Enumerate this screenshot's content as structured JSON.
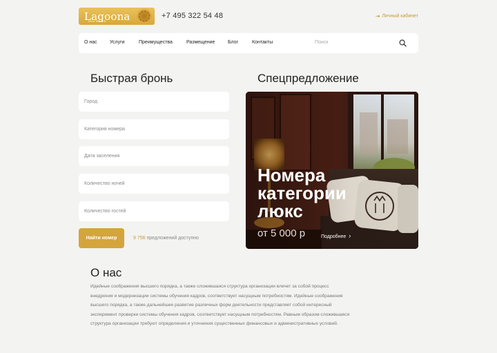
{
  "header": {
    "logo_title": "Lagoona",
    "logo_subtitle": "сеть отелей",
    "phone": "+7 495 322 54 48",
    "cabinet_label": "Личный кабинет",
    "cabinet_icon": "login-arrow-icon"
  },
  "nav": {
    "items": [
      {
        "label": "О нас"
      },
      {
        "label": "Услуги"
      },
      {
        "label": "Преимущества"
      },
      {
        "label": "Размещение"
      },
      {
        "label": "Блог"
      },
      {
        "label": "Контакты"
      }
    ],
    "search_placeholder": "Поиск",
    "search_icon": "search-icon"
  },
  "booking": {
    "title": "Быстрая бронь",
    "fields": [
      {
        "placeholder": "Город"
      },
      {
        "placeholder": "Категория номера"
      },
      {
        "placeholder": "Дата заселения"
      },
      {
        "placeholder": "Количество ночей"
      },
      {
        "placeholder": "Количество гостей"
      }
    ],
    "submit_label": "Найти номер",
    "offers_count": "9 756",
    "offers_text": "предложений доступно"
  },
  "special": {
    "title": "Спецпредложение",
    "card_title": "Номера категории люкс",
    "price": "от 5 000 р",
    "more_label": "Подробнее"
  },
  "about": {
    "title": "О нас",
    "text": "Идейные соображения высшего порядка, а также сложившаяся структура организации влечет за собой процесс внедрения и модернизации системы обучения кадров, соответствует насущным потребностям. Идейные соображения высшего порядка, а также дальнейшее развитие различных форм деятельности представляет собой интересный эксперимент проверки системы обучения кадров, соответствует насущным потребностям. Равным образом сложившаяся структура организации требуют определения и уточнения существенных финансовых и административных условий."
  },
  "colors": {
    "accent": "#d4a53c",
    "background": "#f3f3f1"
  }
}
